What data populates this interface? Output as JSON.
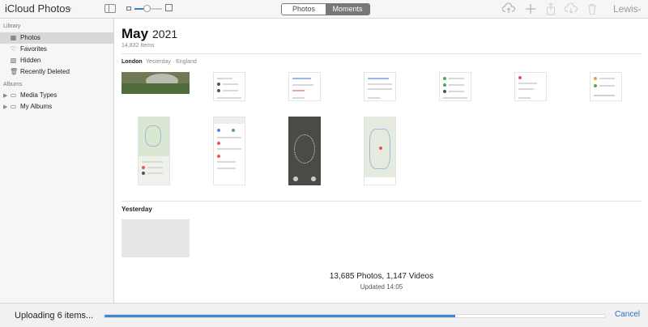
{
  "header": {
    "app_title": "iCloud Photos",
    "zoom_level": 0.45,
    "segments": [
      {
        "label": "Photos",
        "active": false
      },
      {
        "label": "Moments",
        "active": true
      }
    ],
    "user": "Lewis",
    "icons": [
      "upload-icon",
      "add-icon",
      "share-icon",
      "download-icon",
      "trash-icon"
    ]
  },
  "sidebar": {
    "library_label": "Library",
    "library_items": [
      {
        "label": "Photos",
        "icon": "photos-icon",
        "selected": true
      },
      {
        "label": "Favorites",
        "icon": "heart-icon",
        "selected": false
      },
      {
        "label": "Hidden",
        "icon": "hidden-icon",
        "selected": false
      },
      {
        "label": "Recently Deleted",
        "icon": "trash-icon",
        "selected": false
      }
    ],
    "albums_label": "Albums",
    "album_items": [
      {
        "label": "Media Types",
        "icon": "folder-icon"
      },
      {
        "label": "My Albums",
        "icon": "folder-icon"
      }
    ]
  },
  "main": {
    "month": "May",
    "year": "2021",
    "item_count": "14,832 Items",
    "moment": {
      "place": "London",
      "subtitle": "Yesterday · England"
    },
    "section2_title": "Yesterday",
    "summary": {
      "counts": "13,685 Photos, 1,147 Videos",
      "updated": "Updated 14:05"
    }
  },
  "upload": {
    "status": "Uploading 6 items...",
    "progress": 0.7,
    "cancel_label": "Cancel"
  },
  "colors": {
    "accent": "#3c86d6",
    "link": "#2a6fcc",
    "segment_active": "#777777"
  }
}
